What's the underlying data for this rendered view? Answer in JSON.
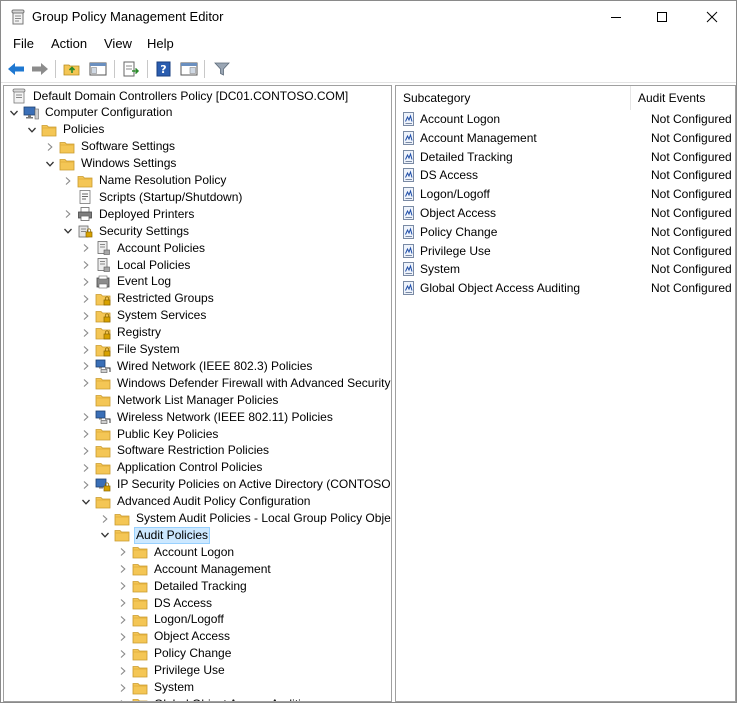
{
  "window": {
    "title": "Group Policy Management Editor"
  },
  "menu": [
    "File",
    "Action",
    "View",
    "Help"
  ],
  "tree": [
    {
      "label": "Default Domain Controllers Policy [DC01.CONTOSO.COM]",
      "depth": 0,
      "toggle": "none",
      "icon": "policy-scroll-icon"
    },
    {
      "label": "Computer Configuration",
      "depth": 0,
      "toggle": "open",
      "icon": "computer-icon"
    },
    {
      "label": "Policies",
      "depth": 1,
      "toggle": "open",
      "icon": "folder-icon"
    },
    {
      "label": "Software Settings",
      "depth": 2,
      "toggle": "closed",
      "icon": "folder-icon"
    },
    {
      "label": "Windows Settings",
      "depth": 2,
      "toggle": "open",
      "icon": "folder-icon"
    },
    {
      "label": "Name Resolution Policy",
      "depth": 3,
      "toggle": "closed",
      "icon": "folder-icon"
    },
    {
      "label": "Scripts (Startup/Shutdown)",
      "depth": 3,
      "toggle": "none",
      "icon": "script-icon"
    },
    {
      "label": "Deployed Printers",
      "depth": 3,
      "toggle": "closed",
      "icon": "printer-icon"
    },
    {
      "label": "Security Settings",
      "depth": 3,
      "toggle": "open",
      "icon": "security-settings-icon"
    },
    {
      "label": "Account Policies",
      "depth": 4,
      "toggle": "closed",
      "icon": "policy-doc-icon"
    },
    {
      "label": "Local Policies",
      "depth": 4,
      "toggle": "closed",
      "icon": "policy-doc-icon"
    },
    {
      "label": "Event Log",
      "depth": 4,
      "toggle": "closed",
      "icon": "event-log-icon"
    },
    {
      "label": "Restricted Groups",
      "depth": 4,
      "toggle": "closed",
      "icon": "locked-folder-icon"
    },
    {
      "label": "System Services",
      "depth": 4,
      "toggle": "closed",
      "icon": "locked-folder-icon"
    },
    {
      "label": "Registry",
      "depth": 4,
      "toggle": "closed",
      "icon": "locked-folder-icon"
    },
    {
      "label": "File System",
      "depth": 4,
      "toggle": "closed",
      "icon": "locked-folder-icon"
    },
    {
      "label": "Wired Network (IEEE 802.3) Policies",
      "depth": 4,
      "toggle": "closed",
      "icon": "network-icon"
    },
    {
      "label": "Windows Defender Firewall with Advanced Security",
      "depth": 4,
      "toggle": "closed",
      "icon": "folder-icon"
    },
    {
      "label": "Network List Manager Policies",
      "depth": 4,
      "toggle": "none",
      "icon": "folder-icon"
    },
    {
      "label": "Wireless Network (IEEE 802.11) Policies",
      "depth": 4,
      "toggle": "closed",
      "icon": "network-icon"
    },
    {
      "label": "Public Key Policies",
      "depth": 4,
      "toggle": "closed",
      "icon": "folder-icon"
    },
    {
      "label": "Software Restriction Policies",
      "depth": 4,
      "toggle": "closed",
      "icon": "folder-icon"
    },
    {
      "label": "Application Control Policies",
      "depth": 4,
      "toggle": "closed",
      "icon": "folder-icon"
    },
    {
      "label": "IP Security Policies on Active Directory (CONTOSO.COM)",
      "depth": 4,
      "toggle": "closed",
      "icon": "ip-security-icon"
    },
    {
      "label": "Advanced Audit Policy Configuration",
      "depth": 4,
      "toggle": "open",
      "icon": "folder-icon"
    },
    {
      "label": "System Audit Policies - Local Group Policy Object",
      "depth": 5,
      "toggle": "closed",
      "icon": "folder-icon"
    },
    {
      "label": "Audit Policies",
      "depth": 5,
      "toggle": "open",
      "icon": "folder-icon",
      "selected": true
    },
    {
      "label": "Account Logon",
      "depth": 6,
      "toggle": "closed",
      "icon": "folder-icon"
    },
    {
      "label": "Account Management",
      "depth": 6,
      "toggle": "closed",
      "icon": "folder-icon"
    },
    {
      "label": "Detailed Tracking",
      "depth": 6,
      "toggle": "closed",
      "icon": "folder-icon"
    },
    {
      "label": "DS Access",
      "depth": 6,
      "toggle": "closed",
      "icon": "folder-icon"
    },
    {
      "label": "Logon/Logoff",
      "depth": 6,
      "toggle": "closed",
      "icon": "folder-icon"
    },
    {
      "label": "Object Access",
      "depth": 6,
      "toggle": "closed",
      "icon": "folder-icon"
    },
    {
      "label": "Policy Change",
      "depth": 6,
      "toggle": "closed",
      "icon": "folder-icon"
    },
    {
      "label": "Privilege Use",
      "depth": 6,
      "toggle": "closed",
      "icon": "folder-icon"
    },
    {
      "label": "System",
      "depth": 6,
      "toggle": "closed",
      "icon": "folder-icon"
    },
    {
      "label": "Global Object Access Auditing",
      "depth": 6,
      "toggle": "closed",
      "icon": "folder-icon"
    }
  ],
  "list": {
    "columns": [
      "Subcategory",
      "Audit Events"
    ],
    "rows": [
      {
        "name": "Account Logon",
        "value": "Not Configured"
      },
      {
        "name": "Account Management",
        "value": "Not Configured"
      },
      {
        "name": "Detailed Tracking",
        "value": "Not Configured"
      },
      {
        "name": "DS Access",
        "value": "Not Configured"
      },
      {
        "name": "Logon/Logoff",
        "value": "Not Configured"
      },
      {
        "name": "Object Access",
        "value": "Not Configured"
      },
      {
        "name": "Policy Change",
        "value": "Not Configured"
      },
      {
        "name": "Privilege Use",
        "value": "Not Configured"
      },
      {
        "name": "System",
        "value": "Not Configured"
      },
      {
        "name": "Global Object Access Auditing",
        "value": "Not Configured"
      }
    ]
  },
  "colors": {
    "selection": "#cce8ff",
    "folder": "#f4c655",
    "toolbar_blue": "#1f78d1"
  }
}
